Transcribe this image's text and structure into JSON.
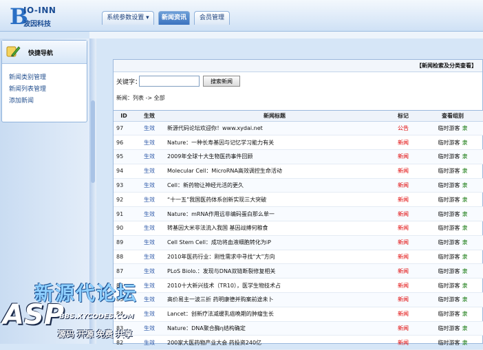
{
  "brand": {
    "logo_letter": "B",
    "logo_name": "IO-INN",
    "logo_subtitle": "波因科技"
  },
  "tabs": [
    {
      "label": "系统参数设置 ▾"
    },
    {
      "label": "新闻资讯"
    },
    {
      "label": "会员管理"
    }
  ],
  "sidebar": {
    "title": "快捷导航",
    "icon": "pencil-notepad-icon",
    "links": [
      "新闻类别管理",
      "新闻列表管理",
      "添加新闻"
    ]
  },
  "search": {
    "panel_title": "【新闻检索及分类查看】",
    "label": "关键字：",
    "value": "",
    "button": "搜索新闻",
    "breadcrumb": "新闻：列表 -> 全部"
  },
  "table": {
    "headers": [
      "ID",
      "生效",
      "新闻标题",
      "标记",
      "查看组别"
    ],
    "rows": [
      {
        "id": "97",
        "status": "生效",
        "title": "新源代码论坛欢迎你！www.xydai.net",
        "tag": "公告",
        "view": "临时游客",
        "view_tag": "隶"
      },
      {
        "id": "96",
        "status": "生效",
        "title": "Nature：一种长寿基因与记忆学习能力有关",
        "tag": "新闻",
        "view": "临时游客",
        "view_tag": "隶"
      },
      {
        "id": "95",
        "status": "生效",
        "title": "2009年全球十大生物医药事件回顾",
        "tag": "新闻",
        "view": "临时游客",
        "view_tag": "隶"
      },
      {
        "id": "94",
        "status": "生效",
        "title": "Molecular Cell：MicroRNA高效调控生命活动",
        "tag": "新闻",
        "view": "临时游客",
        "view_tag": "隶"
      },
      {
        "id": "93",
        "status": "生效",
        "title": "Cell：新药物让神经元活的更久",
        "tag": "新闻",
        "view": "临时游客",
        "view_tag": "隶"
      },
      {
        "id": "92",
        "status": "生效",
        "title": "“十一五”我国医药体系创新实现三大突破",
        "tag": "新闻",
        "view": "临时游客",
        "view_tag": "隶"
      },
      {
        "id": "91",
        "status": "生效",
        "title": "Nature：mRNA作用远非编码蛋白那么单一",
        "tag": "新闻",
        "view": "临时游客",
        "view_tag": "隶"
      },
      {
        "id": "90",
        "status": "生效",
        "title": "转基因大米非法流入我国 基因战搏何粮食",
        "tag": "新闻",
        "view": "临时游客",
        "view_tag": "隶"
      },
      {
        "id": "89",
        "status": "生效",
        "title": "Cell Stem Cell：成功将血液细胞转化为iP",
        "tag": "新闻",
        "view": "临时游客",
        "view_tag": "隶"
      },
      {
        "id": "88",
        "status": "生效",
        "title": "2010年医药行业：刚性需求中寻找“大”方向",
        "tag": "新闻",
        "view": "临时游客",
        "view_tag": "隶"
      },
      {
        "id": "87",
        "status": "生效",
        "title": "PLoS Biolo.：发现与DNA双链断裂修复相关",
        "tag": "新闻",
        "view": "临时游客",
        "view_tag": "隶"
      },
      {
        "id": "86",
        "status": "生效",
        "title": "2010十大新兴技术（TR10），医学生物技术占",
        "tag": "新闻",
        "view": "临时游客",
        "view_tag": "隶"
      },
      {
        "id": "85",
        "status": "生效",
        "title": "高价易主一波三折 药明康德并购案前途未卜",
        "tag": "新闻",
        "view": "临时游客",
        "view_tag": "隶"
      },
      {
        "id": "84",
        "status": "生效",
        "title": "Lancet：创新疗法减缓乳癌晚期的肿瘤生长",
        "tag": "新闻",
        "view": "临时游客",
        "view_tag": "隶"
      },
      {
        "id": "83",
        "status": "生效",
        "title": "Nature：DNA聚合酶η结构确定",
        "tag": "新闻",
        "view": "临时游客",
        "view_tag": "隶"
      },
      {
        "id": "82",
        "status": "生效",
        "title": "200家大医药物产业大会 药投资240亿",
        "tag": "新闻",
        "view": "临时游客",
        "view_tag": "隶"
      }
    ]
  },
  "watermark": {
    "cn": "新源代论坛",
    "asp": "ASP",
    "url": "BBS.XYCODES.COM",
    "tagline": "源码 开源 免费 共享"
  },
  "colors": {
    "accent": "#3b72bf",
    "tag_red": "#e00000",
    "status_blue": "#2b57a8",
    "green": "#1c7d16"
  }
}
